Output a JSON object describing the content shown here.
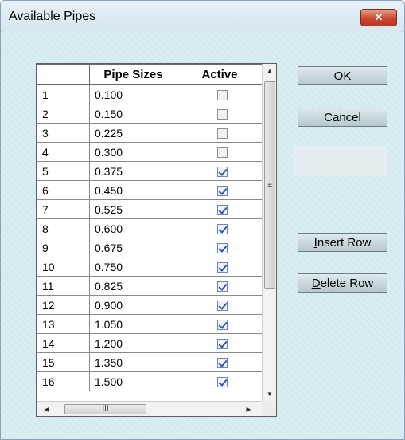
{
  "window": {
    "title": "Available Pipes",
    "close_glyph": "✕"
  },
  "grid": {
    "columns": [
      "",
      "Pipe Sizes",
      "Active"
    ],
    "rows": [
      {
        "num": "1",
        "size": "0.100",
        "active": false
      },
      {
        "num": "2",
        "size": "0.150",
        "active": false
      },
      {
        "num": "3",
        "size": "0.225",
        "active": false
      },
      {
        "num": "4",
        "size": "0.300",
        "active": false
      },
      {
        "num": "5",
        "size": "0.375",
        "active": true
      },
      {
        "num": "6",
        "size": "0.450",
        "active": true
      },
      {
        "num": "7",
        "size": "0.525",
        "active": true
      },
      {
        "num": "8",
        "size": "0.600",
        "active": true
      },
      {
        "num": "9",
        "size": "0.675",
        "active": true
      },
      {
        "num": "10",
        "size": "0.750",
        "active": true
      },
      {
        "num": "11",
        "size": "0.825",
        "active": true
      },
      {
        "num": "12",
        "size": "0.900",
        "active": true
      },
      {
        "num": "13",
        "size": "1.050",
        "active": true
      },
      {
        "num": "14",
        "size": "1.200",
        "active": true
      },
      {
        "num": "15",
        "size": "1.350",
        "active": true
      },
      {
        "num": "16",
        "size": "1.500",
        "active": true
      }
    ]
  },
  "buttons": {
    "ok": "OK",
    "cancel": "Cancel",
    "insert_row_mnemonic": "I",
    "insert_row_rest": "nsert Row",
    "delete_row_mnemonic": "D",
    "delete_row_rest": "elete Row"
  },
  "scroll": {
    "up": "▲",
    "down": "▼",
    "left": "◀",
    "right": "▶",
    "v_grip": "≡",
    "h_grip": "III"
  },
  "colors": {
    "background": "#d4ebee",
    "close_button": "#c9482f",
    "check_accent": "#2e5aa8"
  }
}
